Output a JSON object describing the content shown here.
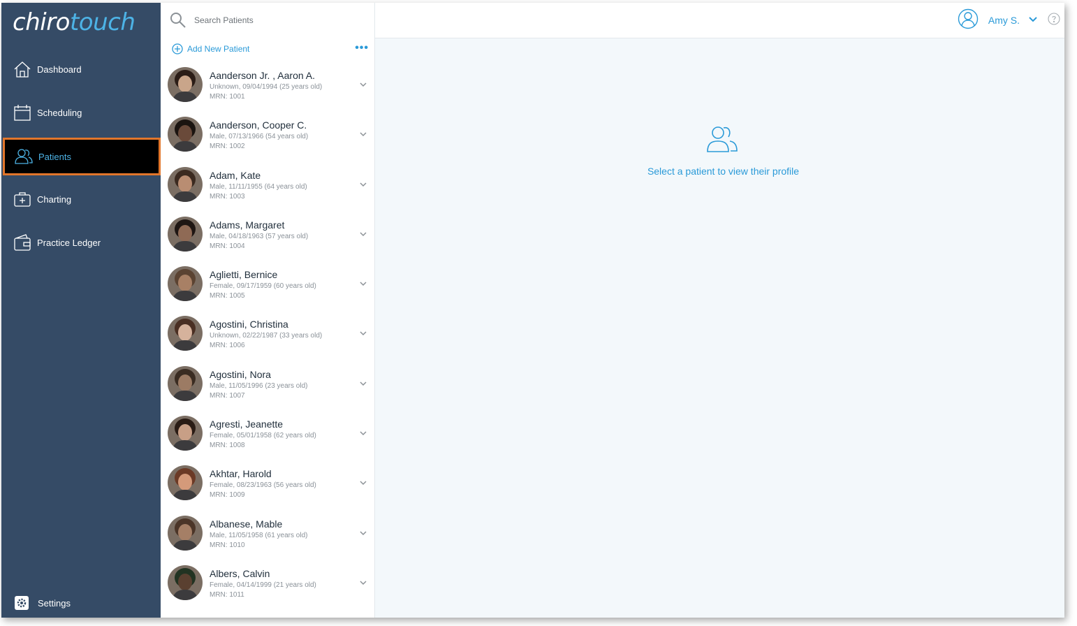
{
  "app": {
    "logo_part1": "chiro",
    "logo_part2": "touch",
    "accent": "#2a9ad8",
    "sidebar_bg": "#354b66",
    "highlight": "#e2762b"
  },
  "sidebar": {
    "items": [
      {
        "label": "Dashboard",
        "icon": "home-icon"
      },
      {
        "label": "Scheduling",
        "icon": "calendar-icon"
      },
      {
        "label": "Patients",
        "icon": "patients-icon",
        "active": true
      },
      {
        "label": "Charting",
        "icon": "medical-kit-icon"
      },
      {
        "label": "Practice Ledger",
        "icon": "wallet-icon"
      }
    ],
    "settings_label": "Settings"
  },
  "search": {
    "placeholder": "Search Patients"
  },
  "list": {
    "add_label": "Add New Patient",
    "more_label": "•••"
  },
  "patients": [
    {
      "name": "Aanderson Jr. , Aaron A.",
      "info": "Unknown, 09/04/1994 (25 years old)",
      "mrn": "MRN: 1001"
    },
    {
      "name": "Aanderson, Cooper C.",
      "info": "Male, 07/13/1966 (54 years old)",
      "mrn": "MRN: 1002"
    },
    {
      "name": "Adam, Kate",
      "info": "Male, 11/11/1955 (64 years old)",
      "mrn": "MRN: 1003"
    },
    {
      "name": "Adams, Margaret",
      "info": "Male, 04/18/1963 (57 years old)",
      "mrn": "MRN: 1004"
    },
    {
      "name": "Aglietti, Bernice",
      "info": "Female, 09/17/1959 (60 years old)",
      "mrn": "MRN: 1005"
    },
    {
      "name": "Agostini, Christina",
      "info": "Unknown, 02/22/1987 (33 years old)",
      "mrn": "MRN: 1006"
    },
    {
      "name": "Agostini, Nora",
      "info": "Male, 11/05/1996 (23 years old)",
      "mrn": "MRN: 1007"
    },
    {
      "name": "Agresti, Jeanette",
      "info": "Female, 05/01/1958 (62 years old)",
      "mrn": "MRN: 1008"
    },
    {
      "name": "Akhtar, Harold",
      "info": "Female, 08/23/1963 (56 years old)",
      "mrn": "MRN: 1009"
    },
    {
      "name": "Albanese, Mable",
      "info": "Male, 11/05/1958 (61 years old)",
      "mrn": "MRN: 1010"
    },
    {
      "name": "Albers, Calvin",
      "info": "Female, 04/14/1999 (21 years old)",
      "mrn": "MRN: 1011"
    }
  ],
  "header": {
    "user_name": "Amy S."
  },
  "main": {
    "empty_message": "Select a patient to view their profile"
  }
}
